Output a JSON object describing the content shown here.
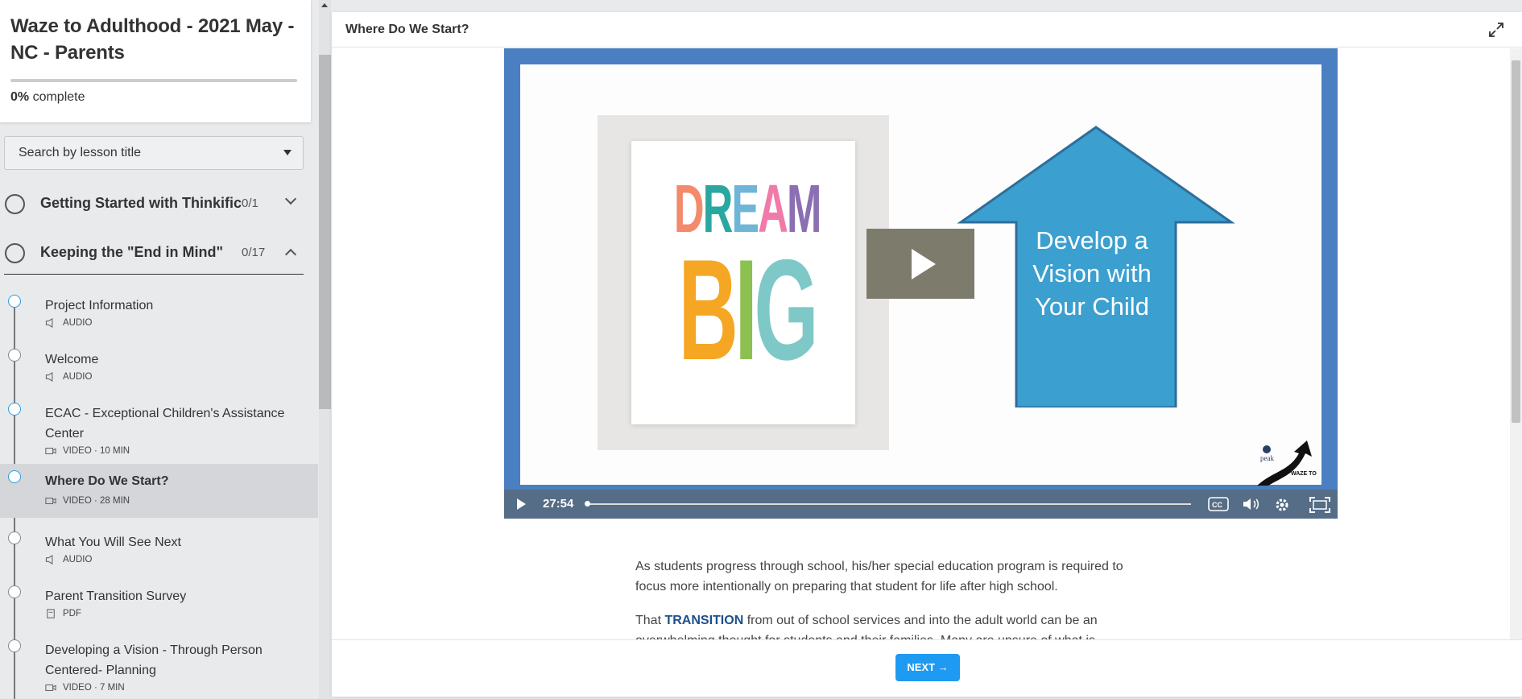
{
  "course": {
    "title": "Waze to Adulthood - 2021 May - NC - Parents",
    "progress_value": "0%",
    "progress_label": "complete",
    "progress_fraction": 0
  },
  "search": {
    "placeholder": "Search by lesson title"
  },
  "chapters": [
    {
      "title": "Getting Started with Thinkific",
      "count": "0/1",
      "expanded": false
    },
    {
      "title": "Keeping the \"End in Mind\"",
      "count": "0/17",
      "expanded": true
    }
  ],
  "lessons": [
    {
      "title": "Project Information",
      "meta": "AUDIO",
      "icon": "speaker-icon",
      "dot": "blue"
    },
    {
      "title": "Welcome",
      "meta": "AUDIO",
      "icon": "speaker-icon",
      "dot": "gray"
    },
    {
      "title": "ECAC - Exceptional Children's Assistance Center",
      "meta": "VIDEO · 10 MIN",
      "icon": "video-camera-icon",
      "dot": "blue"
    },
    {
      "title": "Where Do We Start?",
      "meta": "VIDEO · 28 MIN",
      "icon": "video-camera-icon",
      "dot": "blue",
      "active": true
    },
    {
      "title": "What You Will See Next",
      "meta": "AUDIO",
      "icon": "speaker-icon",
      "dot": "gray"
    },
    {
      "title": "Parent Transition Survey",
      "meta": "PDF",
      "icon": "pdf-icon",
      "dot": "gray"
    },
    {
      "title": "Developing a Vision - Through Person Centered- Planning",
      "meta": "VIDEO · 7 MIN",
      "icon": "video-camera-icon",
      "dot": "gray"
    }
  ],
  "main": {
    "lesson_title": "Where Do We Start?",
    "video": {
      "slide_dream": "DREAM",
      "slide_big": "BIG",
      "arrow_text": "Develop a Vision with Your Child",
      "logo_text": "peak",
      "logo_sub": "WAZE TO",
      "time": "27:54",
      "progress_fraction": 0
    },
    "paragraphs": {
      "p1": "As students progress through school, his/her special education program is required to focus more intentionally on preparing that student for life after high school.",
      "p2_before": "That ",
      "p2_bold": "TRANSITION",
      "p2_after": " from out of school services and into the adult world can be an overwhelming thought for students and their families. Many are unsure of what is necessary at key transition"
    },
    "next_label": "NEXT →"
  },
  "colors": {
    "accent": "#1e9af2",
    "video_border": "#4a7fc1",
    "arrow": "#3b9fd0",
    "transition_word": "#1c4f8c",
    "dream_letters": [
      "#f28a6b",
      "#2aa7a0",
      "#6fb5d8",
      "#f07aa8",
      "#8a6fb3"
    ],
    "big_letters": [
      "#f5a623",
      "#f39c12",
      "#8cc152",
      "#7ec8c8"
    ]
  }
}
